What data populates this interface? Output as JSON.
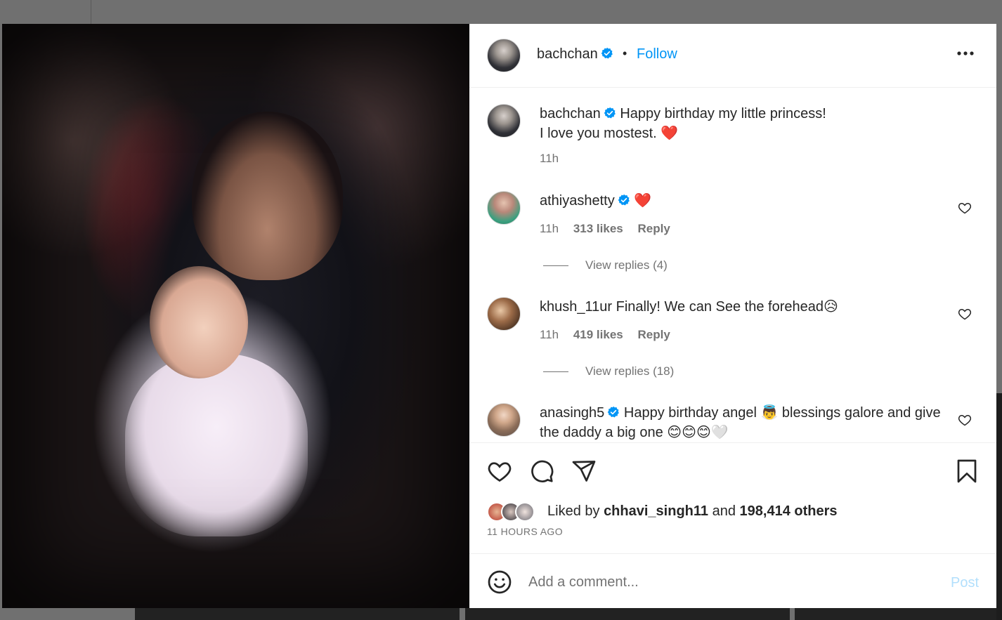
{
  "post": {
    "author": "bachchan",
    "follow_label": "Follow",
    "separator": "•",
    "caption_line1": "Happy birthday my little princess!",
    "caption_line2": "I love you mostest.",
    "caption_emoji": "❤️",
    "caption_time": "11h"
  },
  "comments": [
    {
      "username": "athiyashetty",
      "text": "❤️",
      "time": "11h",
      "likes": "313 likes",
      "reply": "Reply",
      "view_replies": "View replies (4)"
    },
    {
      "username": "khush_11ur",
      "text": "Finally! We can See the forehead😥",
      "time": "11h",
      "likes": "419 likes",
      "reply": "Reply",
      "view_replies": "View replies (18)"
    },
    {
      "username": "anasingh5",
      "text": "Happy birthday angel 👼 blessings galore and give the daddy a big one 😊😊😊🤍"
    }
  ],
  "likes": {
    "prefix": "Liked by",
    "first_liker": "chhavi_singh11",
    "conjunction": "and",
    "others": "198,414 others",
    "time_ago": "11 HOURS AGO"
  },
  "composer": {
    "placeholder": "Add a comment...",
    "post_label": "Post"
  },
  "colors": {
    "accent": "#0095f6",
    "verified": "#0095f6",
    "post_disabled": "#b2dffc",
    "heart": "#ed1c24"
  }
}
